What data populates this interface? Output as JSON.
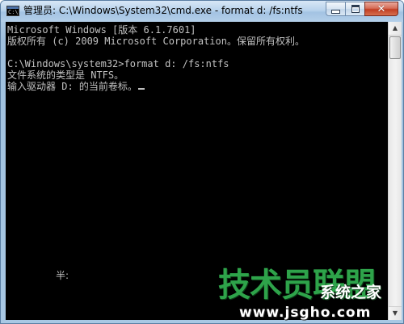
{
  "window": {
    "title": "管理员: C:\\Windows\\System32\\cmd.exe - format  d: /fs:ntfs",
    "icon": "cmd-console-icon",
    "icon_glyph": "C:\\",
    "controls": {
      "minimize_icon": "minimize-icon",
      "maximize_icon": "maximize-icon",
      "close_icon": "close-icon",
      "close_glyph": "✕"
    }
  },
  "console": {
    "background": "#000000",
    "foreground": "#c0c0c0",
    "lines": [
      "Microsoft Windows [版本 6.1.7601]",
      "版权所有 (c) 2009 Microsoft Corporation。保留所有权利。",
      "",
      "C:\\Windows\\system32>format d: /fs:ntfs",
      "文件系统的类型是 NTFS。",
      "输入驱动器 D: 的当前卷标。"
    ],
    "ime_status": "半:"
  },
  "scrollbar": {
    "up_glyph": "▲",
    "down_glyph": "▼"
  },
  "watermark": {
    "title": "技术员联盟",
    "subtitle": "系统之家",
    "url": "www.jsgho.com",
    "color": "#2ea34a"
  }
}
